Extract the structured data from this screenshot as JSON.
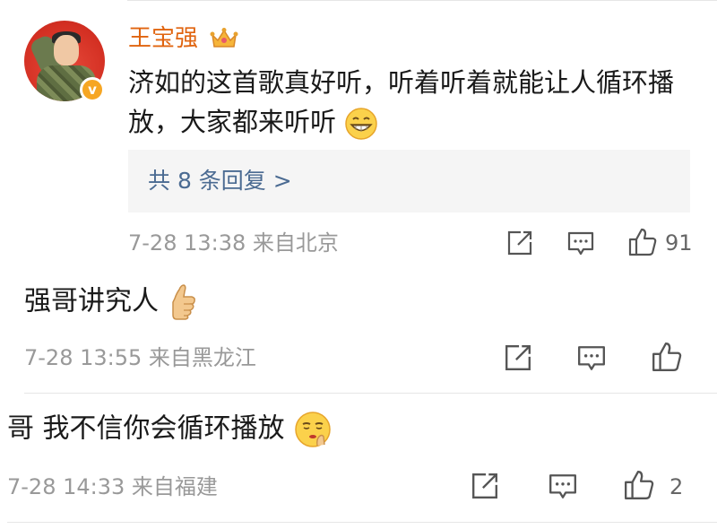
{
  "main_comment": {
    "username": "王宝强",
    "verified_badge": "v",
    "text": "济如的这首歌真好听，听着听着就能让人循环播放，大家都来听听",
    "replies_link": "共 8 条回复 >",
    "meta": "7-28 13:38  来自北京",
    "like_count": "91"
  },
  "replies": [
    {
      "text": "强哥讲究人",
      "emoji": "thumbs-up",
      "meta": "7-28 13:55  来自黑龙江",
      "like_count": ""
    },
    {
      "text": "哥 我不信你会循环播放",
      "emoji": "shushing-face",
      "meta": "7-28 14:33  来自福建",
      "like_count": "2"
    }
  ],
  "icons": [
    "share-icon",
    "comment-icon",
    "like-icon",
    "crown-icon",
    "grin-emoji"
  ],
  "colors": {
    "username": "#e0640f",
    "link": "#4b6b92",
    "meta": "#999999",
    "badge": "#f6a623"
  }
}
